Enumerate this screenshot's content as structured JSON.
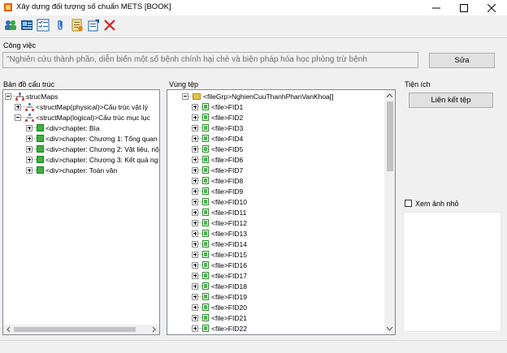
{
  "window": {
    "title": "Xây dựng đối tượng số chuẩn METS [BOOK]"
  },
  "toolbar": {
    "icons": [
      "users-icon",
      "id-card-icon",
      "checklist-icon",
      "paperclip-icon",
      "document-icon",
      "export-icon",
      "delete-icon"
    ]
  },
  "task": {
    "label": "Công việc",
    "value": "\"Nghiên cứu thành phần, diễn biến một số bệnh chính hại chè  và biện pháp hóa học phòng trừ bệnh",
    "edit_button": "Sửa"
  },
  "structure_map": {
    "label": "Bản đồ cấu trúc",
    "root": "strucMaps",
    "nodes": [
      {
        "text": "<structMap(physical)>Cấu trúc vật lý"
      },
      {
        "text": "<structMap(logical)>Cấu trúc mục lục"
      }
    ],
    "chapters": [
      "<div>chapter: Bìa",
      "<div>chapter: Chương 1: Tổng quan",
      "<div>chapter: Chương 2: Vật liệu, nội",
      "<div>chapter: Chương 3: Kết quả ng",
      "<div>chapter: Toàn văn"
    ]
  },
  "file_area": {
    "label": "Vùng tệp",
    "group": "<fileGrp>NghienCuuThanhPhanVanKhoa[]",
    "files": [
      "<file>FID1",
      "<file>FID2",
      "<file>FID3",
      "<file>FID4",
      "<file>FID5",
      "<file>FID6",
      "<file>FID7",
      "<file>FID8",
      "<file>FID9",
      "<file>FID10",
      "<file>FID11",
      "<file>FID12",
      "<file>FID13",
      "<file>FID14",
      "<file>FID15",
      "<file>FID16",
      "<file>FID17",
      "<file>FID18",
      "<file>FID19",
      "<file>FID20",
      "<file>FID21",
      "<file>FID22"
    ]
  },
  "utilities": {
    "label": "Tiện ích",
    "link_button": "Liên kết tệp",
    "thumbnail_checkbox": "Xem ảnh nhỏ"
  }
}
